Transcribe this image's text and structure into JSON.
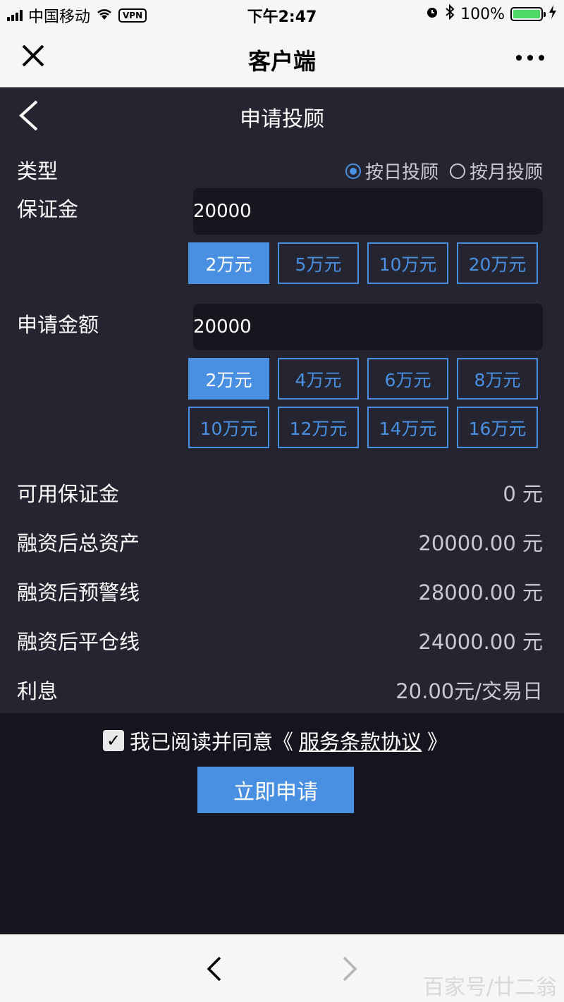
{
  "status_bar": {
    "carrier": "中国移动",
    "vpn": "VPN",
    "time": "下午2:47",
    "battery_percent": "100%"
  },
  "wechat_bar": {
    "title": "客户端"
  },
  "page": {
    "title": "申请投顾",
    "type_label": "类型",
    "type_options": [
      "按日投顾",
      "按月投顾"
    ],
    "type_selected": "按日投顾",
    "deposit_label": "保证金",
    "deposit_value": "20000",
    "deposit_chips": [
      "2万元",
      "5万元",
      "10万元",
      "20万元"
    ],
    "deposit_selected": "2万元",
    "amount_label": "申请金额",
    "amount_value": "20000",
    "amount_chips": [
      "2万元",
      "4万元",
      "6万元",
      "8万元",
      "10万元",
      "12万元",
      "14万元",
      "16万元"
    ],
    "amount_selected": "2万元",
    "info": [
      {
        "label": "可用保证金",
        "value": "0 元"
      },
      {
        "label": "融资后总资产",
        "value": "20000.00 元"
      },
      {
        "label": "融资后预警线",
        "value": "28000.00 元"
      },
      {
        "label": "融资后平仓线",
        "value": "24000.00 元"
      },
      {
        "label": "利息",
        "value": "20.00元/交易日"
      }
    ]
  },
  "agreement": {
    "text": "我已阅读并同意《",
    "link": "服务条款协议",
    "suffix": "》",
    "checked": true
  },
  "submit_label": "立即申请",
  "watermark": "百家号/廿二翁",
  "colors": {
    "accent": "#4a90e2",
    "page_bg": "#242530",
    "footer_bg": "#14151f"
  }
}
